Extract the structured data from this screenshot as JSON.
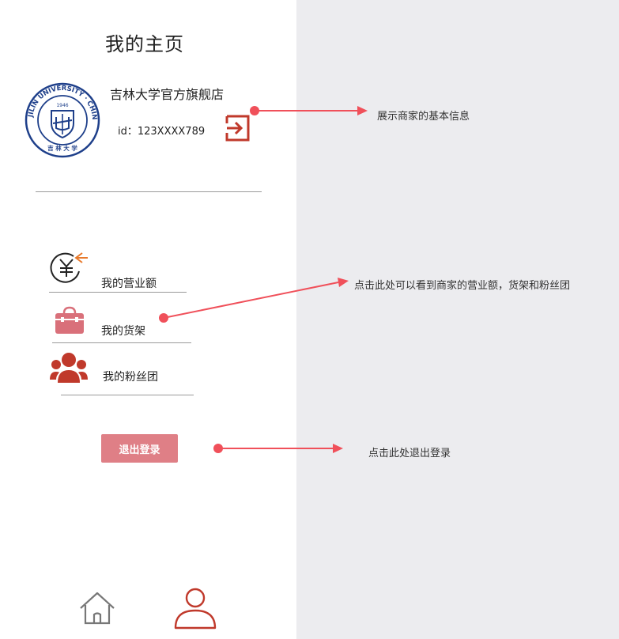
{
  "colors": {
    "accent": "#c0392b",
    "button": "#df7f86",
    "arrow": "#f0505a",
    "panel": "#ececef",
    "income_arrow": "#e8792b",
    "logo_blue": "#1e3f8a"
  },
  "page": {
    "title": "我的主页"
  },
  "profile": {
    "store_name": "吉林大学官方旗舰店",
    "id_text": "id：123XXXX789",
    "logo": {
      "ring_text": "JILIN UNIVERSITY · CHINA",
      "year": "1946",
      "seal_chars": "吉 林 大 学"
    }
  },
  "menu": {
    "items": [
      {
        "label": "我的营业额",
        "icon": "yuan-income-icon"
      },
      {
        "label": "我的货架",
        "icon": "shopping-bag-icon"
      },
      {
        "label": "我的粉丝团",
        "icon": "fans-group-icon"
      }
    ]
  },
  "logout": {
    "label": "退出登录"
  },
  "annotations": {
    "profile": "展示商家的基本信息",
    "menu": "点击此处可以看到商家的营业额，货架和粉丝团",
    "logout": "点击此处退出登录"
  },
  "bottom_nav": {
    "items": [
      {
        "icon": "home-icon"
      },
      {
        "icon": "user-icon"
      }
    ]
  }
}
